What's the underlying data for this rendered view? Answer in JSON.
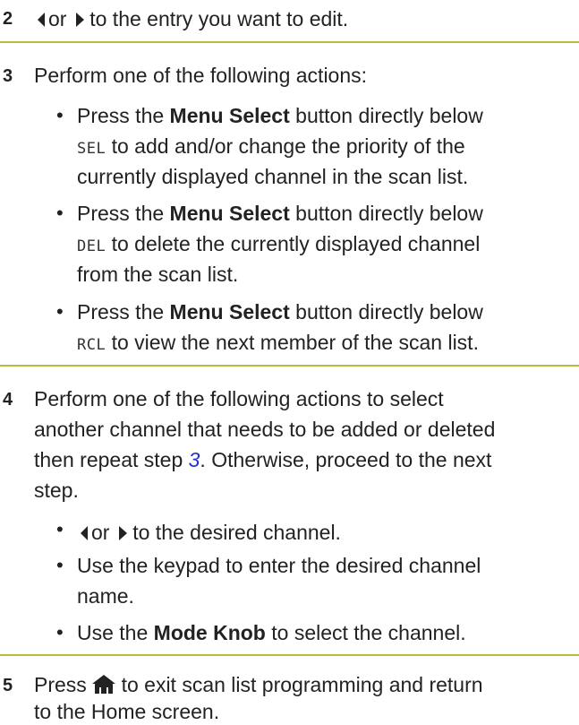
{
  "steps": [
    {
      "number": "2",
      "before_left": "",
      "or_word": "or",
      "text": "to the entry you want to edit."
    },
    {
      "number": "3",
      "intro": "Perform one of the following actions:",
      "bullets": [
        {
          "prefix": "Press the",
          "bold": "Menu Select",
          "after_bold": "button directly below",
          "lcd": "SEL",
          "line2_rest": "to add and/or change the priority of the",
          "line3": "currently displayed channel in the scan list."
        },
        {
          "prefix": "Press the",
          "bold": "Menu Select",
          "after_bold": "button directly below",
          "lcd": "DEL",
          "line2_rest": "to delete the currently displayed channel",
          "line3": "from the scan list."
        },
        {
          "prefix": "Press the",
          "bold": "Menu Select",
          "after_bold": "button directly below",
          "lcd": "RCL",
          "line2_rest": "to view the next member of the scan list."
        }
      ]
    },
    {
      "number": "4",
      "intro_line1": "Perform one of the following actions to select",
      "intro_line2": "another channel that needs to be added or deleted",
      "intro_line3_before": "then repeat step",
      "intro_link": "3",
      "intro_line3_after": ". Otherwise, proceed to the next",
      "intro_line4": "step.",
      "bullets": {
        "b1_or": "or",
        "b1_rest": "to the desired channel.",
        "b2_line1": "Use the keypad to enter the desired channel",
        "b2_line2": "name.",
        "b3_prefix": "Use the",
        "b3_bold": "Mode Knob",
        "b3_rest": "to select the channel."
      }
    },
    {
      "number": "5",
      "press": "Press",
      "line1_rest": "to exit scan list programming and return",
      "line2": "to the Home screen."
    }
  ],
  "bullet_char": "•",
  "icons": [
    "left-arrow-icon",
    "right-arrow-icon",
    "home-icon"
  ],
  "colors": {
    "rule": "#b8bc3a",
    "link": "#2233cc",
    "text": "#222222"
  }
}
